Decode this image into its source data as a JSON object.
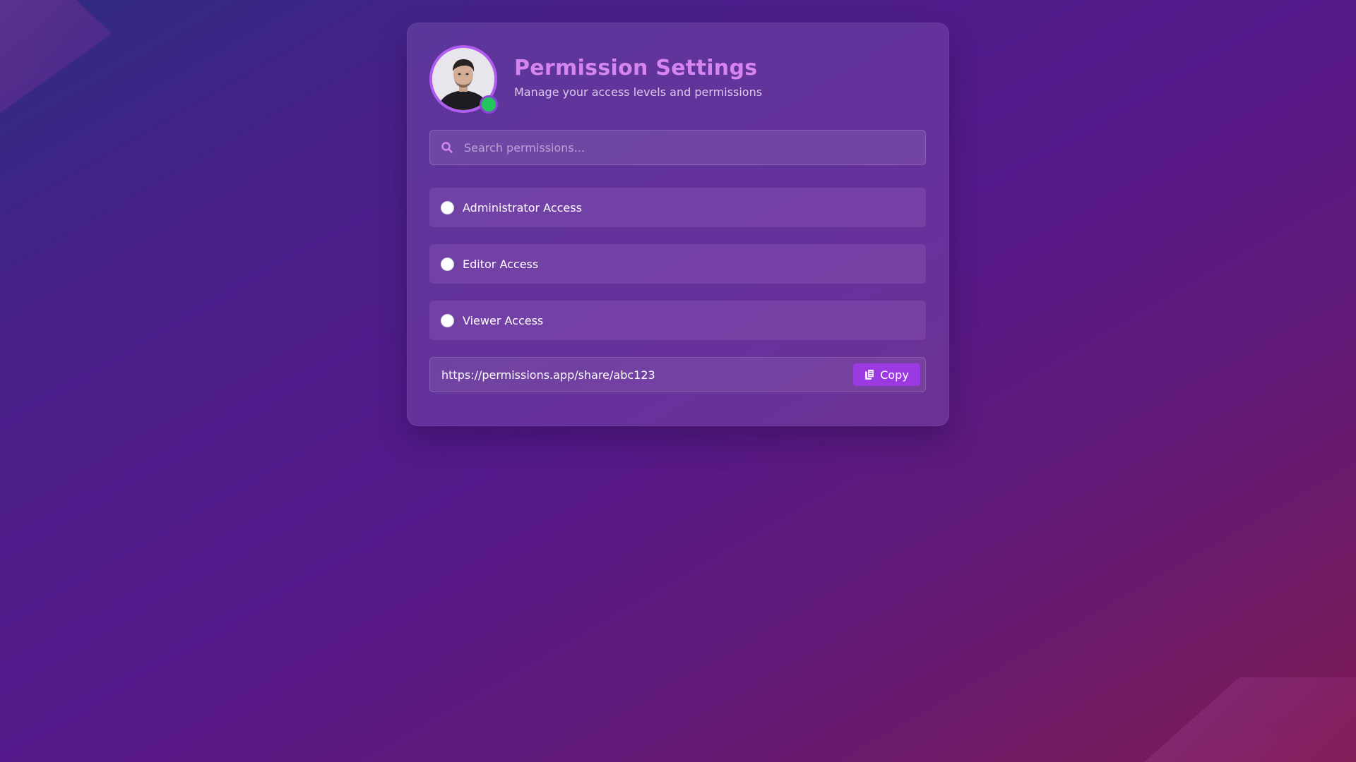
{
  "header": {
    "title": "Permission Settings",
    "subtitle": "Manage your access levels and permissions",
    "avatar_icon": "user-avatar-photo",
    "online": true
  },
  "search": {
    "placeholder": "Search permissions...",
    "value": "",
    "icon": "search-icon"
  },
  "permissions": {
    "options": [
      {
        "label": "Administrator Access",
        "selected": false
      },
      {
        "label": "Editor Access",
        "selected": false
      },
      {
        "label": "Viewer Access",
        "selected": false
      }
    ]
  },
  "share": {
    "url": "https://permissions.app/share/abc123",
    "copy_label": "Copy",
    "copy_icon": "copy-icon"
  },
  "colors": {
    "accent": "#9a3ae0",
    "title": "#d685ef",
    "status_online": "#22c55e",
    "avatar_ring": "#b05cf0"
  }
}
